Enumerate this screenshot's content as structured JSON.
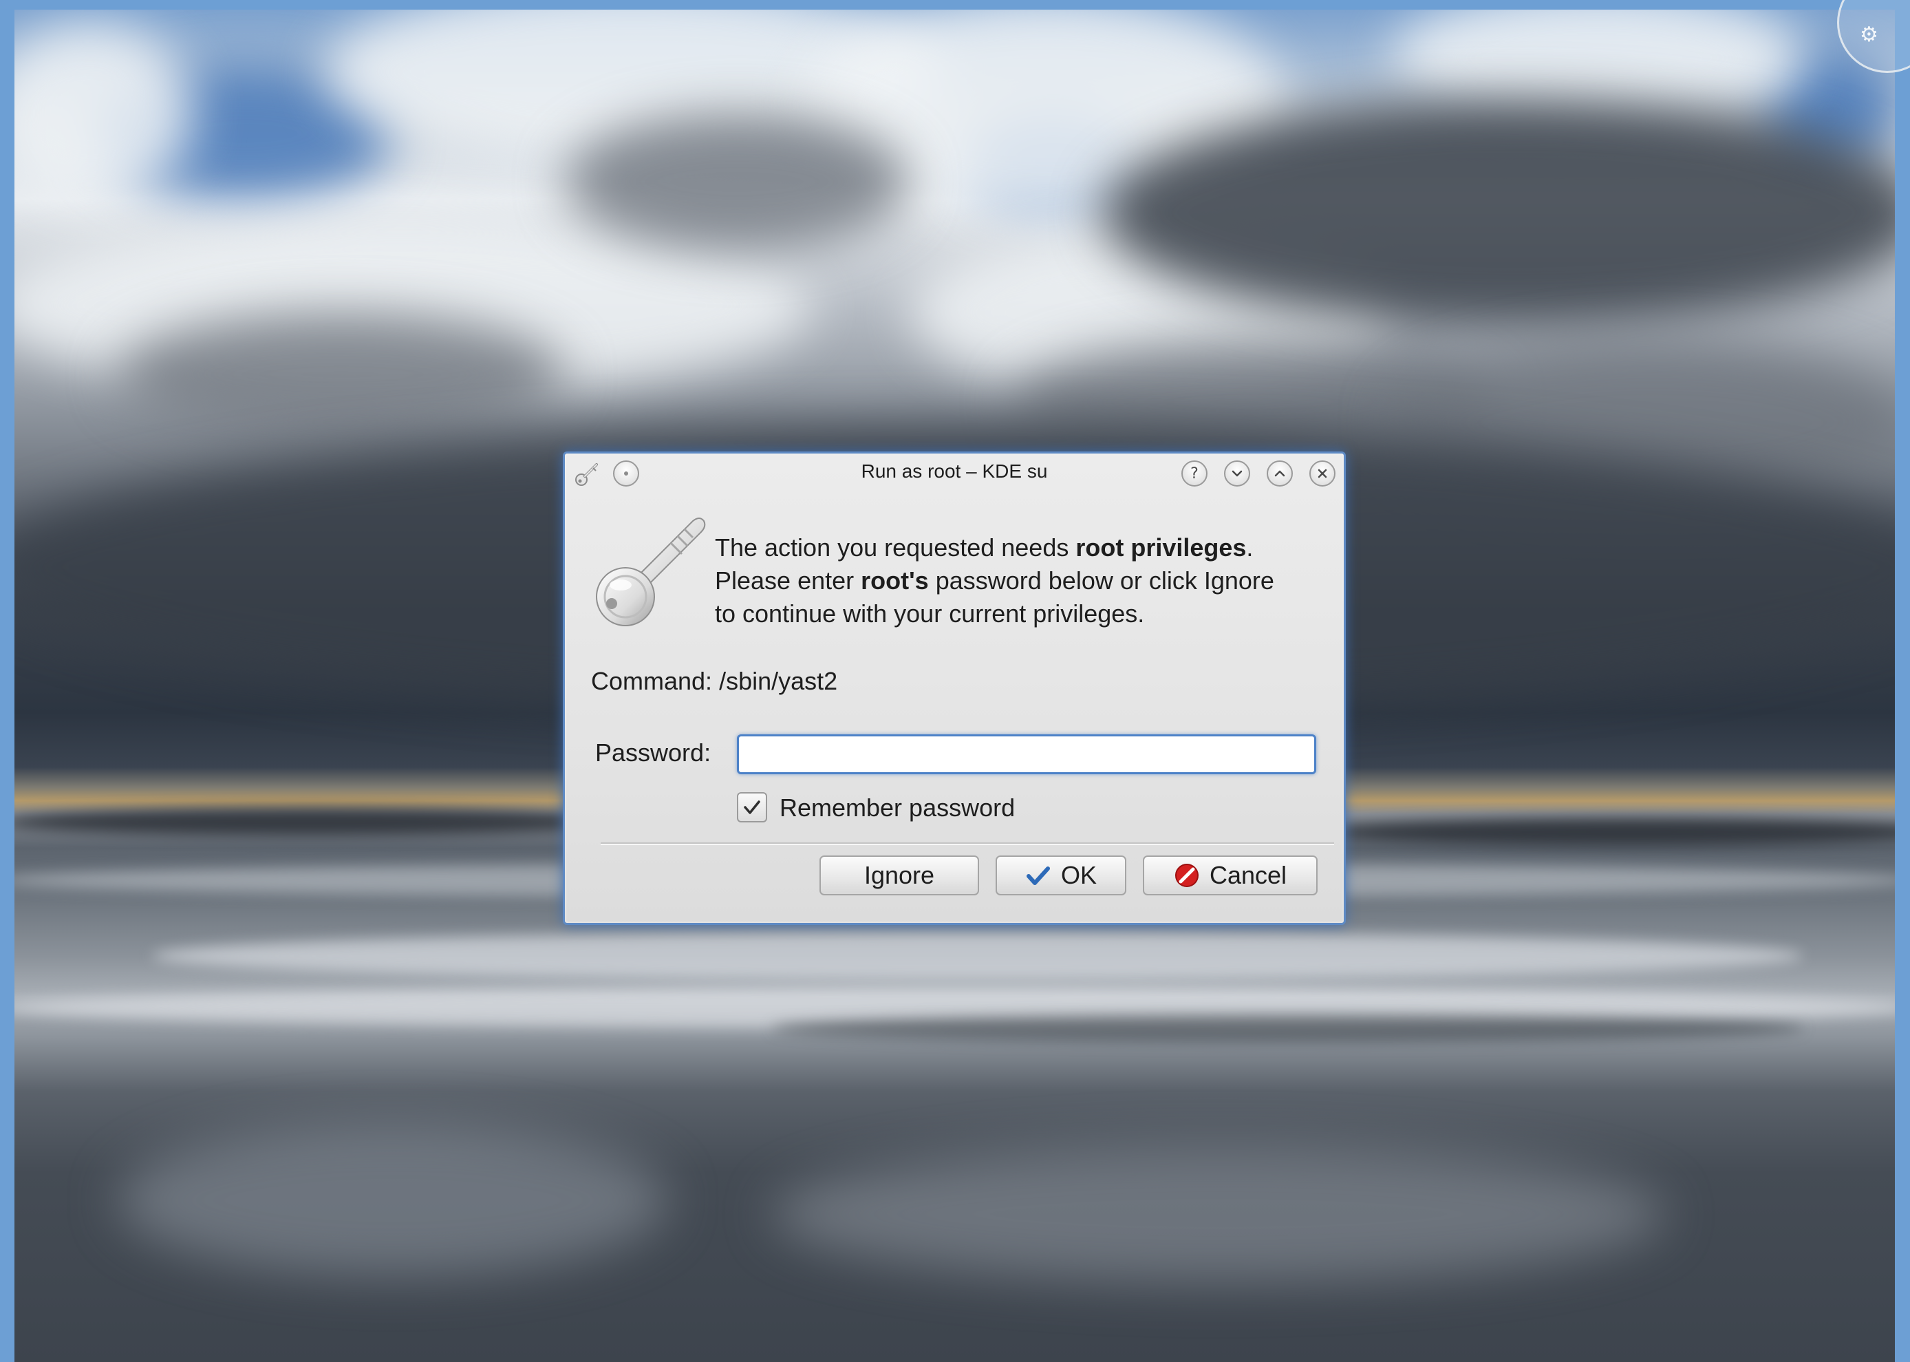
{
  "dialog": {
    "title": "Run as root – KDE su",
    "message": {
      "line1_prefix": "The action you requested needs ",
      "line1_bold": "root privileges",
      "line1_suffix": ".",
      "line2_prefix": "Please enter ",
      "line2_bold": "root's",
      "line2_suffix": " password below or click Ignore",
      "line3": "to continue with your current privileges."
    },
    "command_label": "Command:",
    "command_value": "/sbin/yast2",
    "password_label": "Password:",
    "password_value": "",
    "remember_label": "Remember password",
    "remember_checked": true,
    "buttons": {
      "ignore": "Ignore",
      "ok": "OK",
      "cancel": "Cancel"
    },
    "titlebar_buttons": {
      "help": "?",
      "minimize": "chevron-down-icon",
      "maximize": "chevron-up-icon",
      "close": "close-icon"
    }
  },
  "icons": {
    "app": "key-icon",
    "pin": "pin-icon",
    "ok": "checkmark-icon",
    "cancel": "cancel-icon"
  },
  "colors": {
    "dialog_border": "#5e8ac4",
    "focus_blue": "#4d82c8",
    "ok_check": "#2d6ab8",
    "cancel_red": "#d42020"
  }
}
